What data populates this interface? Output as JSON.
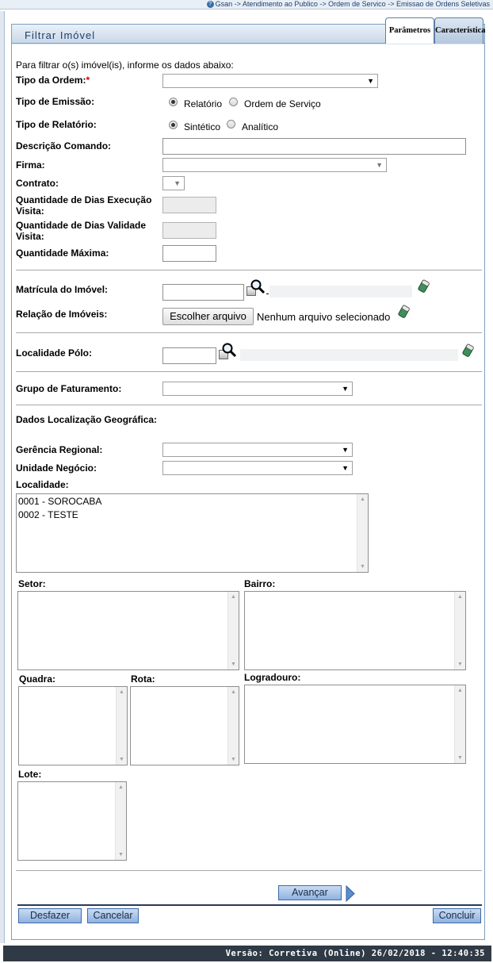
{
  "breadcrumb": "Gsan -> Atendimento ao Publico -> Ordem de Servico -> Emissao de Ordens Seletivas",
  "panel": {
    "title": "Filtrar Imóvel"
  },
  "tabs": [
    {
      "label": "Parâmetros",
      "active": true
    },
    {
      "label": "Característica",
      "active": false
    }
  ],
  "form": {
    "intro": "Para filtrar o(s) imóvel(is), informe os dados abaixo:",
    "tipo_ordem": {
      "label": "Tipo da Ordem:",
      "required_mark": "*",
      "value": ""
    },
    "tipo_emissao": {
      "label": "Tipo de Emissão:",
      "options": [
        "Relatório",
        "Ordem de Serviço"
      ],
      "selected": "Relatório"
    },
    "tipo_relatorio": {
      "label": "Tipo de Relatório:",
      "options": [
        "Sintético",
        "Analítico"
      ],
      "selected": "Sintético"
    },
    "descricao_comando": {
      "label": "Descrição Comando:",
      "value": ""
    },
    "firma": {
      "label": "Firma:",
      "value": ""
    },
    "contrato": {
      "label": "Contrato:",
      "value": ""
    },
    "dias_execucao": {
      "label_1": "Quantidade de Dias Execução",
      "label_2": "Visita:",
      "value": ""
    },
    "dias_validade": {
      "label_1": "Quantidade de Dias Validade",
      "label_2": "Visita:",
      "value": ""
    },
    "quantidade_maxima": {
      "label": "Quantidade Máxima:",
      "value": ""
    },
    "matricula_imovel": {
      "label": "Matrícula do Imóvel:",
      "value": "",
      "description": ""
    },
    "relacao_imoveis": {
      "label": "Relação de Imóveis:",
      "button": "Escolher arquivo",
      "status": "Nenhum arquivo selecionado"
    },
    "localidade_polo": {
      "label": "Localidade Pólo:",
      "value": "",
      "description": ""
    },
    "grupo_faturamento": {
      "label": "Grupo de Faturamento:",
      "value": ""
    },
    "geo_title": "Dados Localização Geográfica:",
    "gerencia_regional": {
      "label": "Gerência Regional:",
      "value": ""
    },
    "unidade_negocio": {
      "label": "Unidade Negócio:",
      "value": ""
    },
    "localidade": {
      "label": "Localidade:",
      "options": [
        "0001 - SOROCABA",
        "0002 - TESTE"
      ]
    },
    "setor": {
      "label": "Setor:"
    },
    "bairro": {
      "label": "Bairro:"
    },
    "quadra": {
      "label": "Quadra:"
    },
    "rota": {
      "label": "Rota:"
    },
    "logradouro": {
      "label": "Logradouro:"
    },
    "lote": {
      "label": "Lote:"
    }
  },
  "buttons": {
    "avancar": "Avançar",
    "desfazer": "Desfazer",
    "cancelar": "Cancelar",
    "concluir": "Concluir"
  },
  "footer": "Versão: Corretiva (Online) 26/02/2018 - 12:40:35",
  "colors": {
    "panel_border": "#7f9dc0",
    "button_blue": "#8fb2df",
    "required": "#cc0000",
    "footer_bg": "#2f3a46"
  },
  "icons": [
    "help-icon",
    "search-icon",
    "document-icon",
    "eraser-icon",
    "next-arrow-icon",
    "dropdown-arrow-icon"
  ]
}
